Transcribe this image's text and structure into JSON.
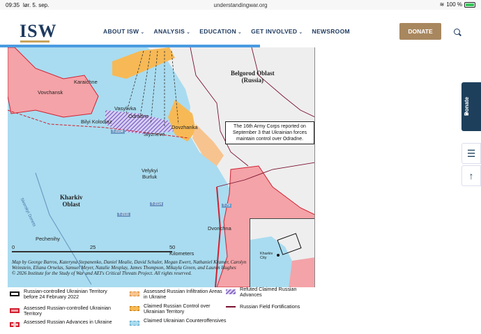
{
  "status_bar": {
    "time": "09:35",
    "date": "lør. 5. sep.",
    "url": "understandingwar.org",
    "battery": "100 %"
  },
  "header": {
    "logo": "ISW",
    "nav": [
      {
        "label": "ABOUT ISW",
        "has_dropdown": true
      },
      {
        "label": "ANALYSIS",
        "has_dropdown": true
      },
      {
        "label": "EDUCATION",
        "has_dropdown": true
      },
      {
        "label": "GET INVOLVED",
        "has_dropdown": true
      },
      {
        "label": "NEWSROOM",
        "has_dropdown": false
      }
    ],
    "donate_label": "DONATE",
    "accent_color": "#a8875f",
    "reading_progress": 0.54
  },
  "map": {
    "places": {
      "vovchansk": "Vovchansk",
      "karaichne": "Karaichne",
      "vasylivka": "Vasylivka",
      "bilyi_kolodiaz": "Bilyi Kolodiaz",
      "odradne": "Odradne",
      "dovzhanka": "Dovzhanka",
      "slyzneve": "Slyzneve",
      "velykyi_burluk": "Velykyi\nBurluk",
      "pechenihy": "Pechenihy",
      "dvorichna": "Dvorichna",
      "siverskyi_donets": "Siverskyi Donets"
    },
    "regions": {
      "belgorod": "Belgorod Oblast\n(Russia)",
      "kharkiv": "Kharkiv\nOblast"
    },
    "roads": [
      "T-2104",
      "T-2114",
      "T-2111",
      "T-79"
    ],
    "callout": "The 16th Army Corps reported on September 3 that Ukrainian forces maintain control over Odradne.",
    "inset_label": "Kharkiv\nCity",
    "scale": {
      "zero": "0",
      "mid": "25",
      "end": "50 Kilometers"
    },
    "credits": "Map by George Barros, Kateryna Stepanenko, Daniel Mealie, David Schuler, Megan Ewert, Nathaniel Kramer, Carolyn Weinstein, Eliana Ornelas, Samuel Meyer, Natalie Mesplay, James Thompson, Mikayla Green, and Lauren Hughes\n© 2026 Institute for the Study of War and AEI's Critical Threats Project. All rights reserved."
  },
  "legend": [
    {
      "label": "Russian-controlled Ukrainian Territory before 24 February 2022",
      "color": "#ffffff"
    },
    {
      "label": "Assessed Russian-controlled Ukrainian Territory",
      "color": "#f4a3a8"
    },
    {
      "label": "Assessed Russian Advances in Ukraine",
      "color": "#f9c9c9"
    },
    {
      "label": "Assessed Russian Infiltration Areas in Ukraine",
      "color": "#f7c48f"
    },
    {
      "label": "Claimed Russian Control over Ukrainian Territory",
      "color": "#f7b955"
    },
    {
      "label": "Claimed Ukrainian Counteroffensives",
      "color": "#a9dcf0"
    },
    {
      "label": "Refuted Claimed Russian Advances",
      "color": "#8b6bc8"
    },
    {
      "label": "Russian Field Fortifications",
      "color": "#7a1030"
    }
  ],
  "side": {
    "donate": "Donate"
  }
}
